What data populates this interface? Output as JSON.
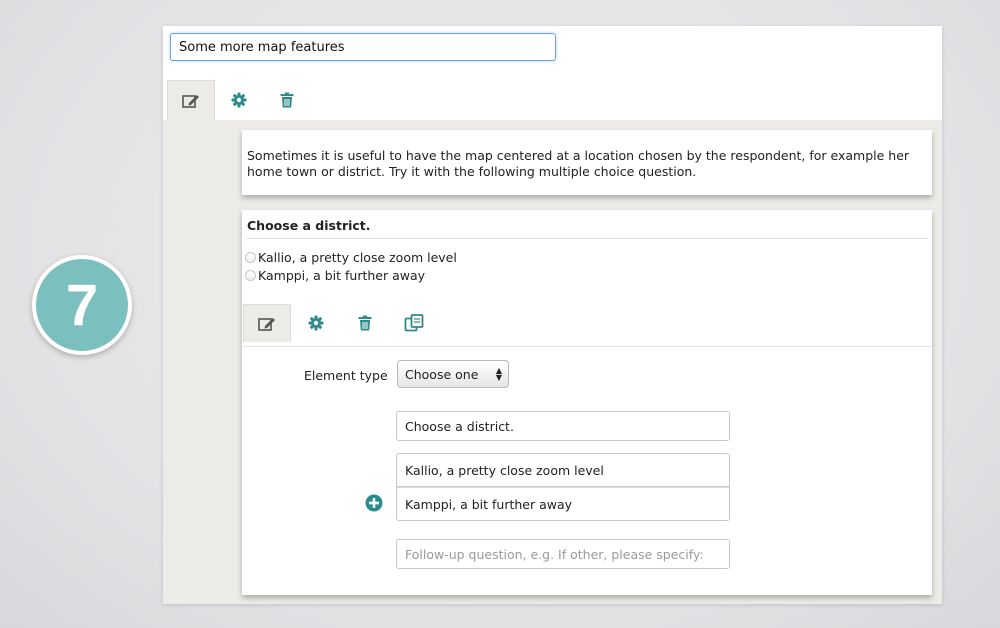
{
  "step_badge": {
    "number": "7"
  },
  "colors": {
    "accent": "#2e8b8b",
    "badge": "#7cbfbf",
    "canvas": "#ecebe7"
  },
  "section": {
    "title_value": "Some more map features",
    "toolbar": [
      "edit-icon",
      "gear-icon",
      "trash-icon"
    ]
  },
  "intro": {
    "text": "Sometimes it is useful to have the map centered at a location chosen by the respondent, for example her home town or district. Try it with the following multiple choice question."
  },
  "question": {
    "title": "Choose a district.",
    "options": [
      {
        "label": "Kallio, a pretty close zoom level"
      },
      {
        "label": "Kamppi, a bit further away"
      }
    ],
    "toolbar": [
      "edit-icon",
      "gear-icon",
      "trash-icon",
      "copy-icon"
    ]
  },
  "editor": {
    "element_type_label": "Element type",
    "element_type_value": "Choose one",
    "question_value": "Choose a district.",
    "option_values": [
      "Kallio, a pretty close zoom level",
      "Kamppi, a bit further away"
    ],
    "followup_placeholder": "Follow-up question, e.g. If other, please specify:"
  }
}
